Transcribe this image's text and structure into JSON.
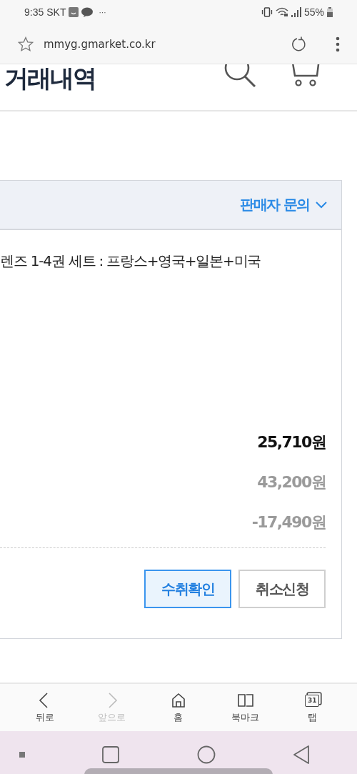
{
  "status_bar": {
    "time": "9:35",
    "carrier": "SKT",
    "more": "···",
    "battery": "55%"
  },
  "browser": {
    "url": "mmyg.gmarket.co.kr"
  },
  "header": {
    "title": "거래내역"
  },
  "order": {
    "seller_inquiry": "판매자 문의",
    "product": "렌즈 1-4권 세트 : 프랑스+영국+일본+미국",
    "prices": [
      {
        "text": "25,710원",
        "kind": "total"
      },
      {
        "text": "43,200원",
        "kind": "sub"
      },
      {
        "text": "-17,490원",
        "kind": "sub"
      }
    ],
    "buttons": [
      {
        "label": "수취확인",
        "primary": true
      },
      {
        "label": "취소신청",
        "primary": false
      }
    ]
  },
  "bottom_nav": [
    {
      "label": "뒤로",
      "kind": "back",
      "disabled": false
    },
    {
      "label": "앞으로",
      "kind": "forward",
      "disabled": true
    },
    {
      "label": "홈",
      "kind": "home",
      "disabled": false
    },
    {
      "label": "북마크",
      "kind": "bookmark",
      "disabled": false
    },
    {
      "label": "탭",
      "kind": "tabs",
      "disabled": false,
      "count": "31"
    }
  ]
}
